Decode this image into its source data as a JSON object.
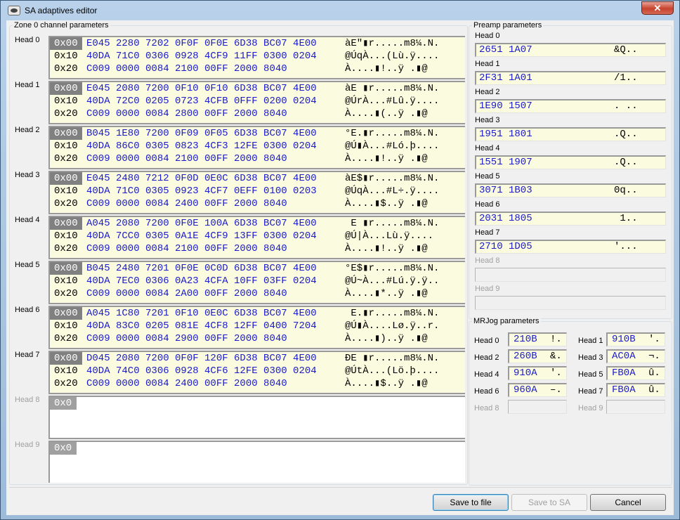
{
  "window": {
    "title": "SA adaptives editor",
    "close_glyph": "✕"
  },
  "zone": {
    "legend": "Zone 0 channel parameters",
    "heads": [
      {
        "label": "Head 0",
        "rows": [
          {
            "offset": "0x00",
            "words": "E045 2280 7202 0F0F 0F0E 6D38 BC07 4E00",
            "ascii": "àE\"▮r.....m8¼.N."
          },
          {
            "offset": "0x10",
            "words": "40DA 71C0 0306 0928 4CF9 11FF 0300 0204",
            "ascii": "@ÚqÀ...(Lù.ÿ...."
          },
          {
            "offset": "0x20",
            "words": "C009 0000 0084 2100 00FF 2000 8040",
            "ascii": "À....▮!..ÿ .▮@"
          }
        ]
      },
      {
        "label": "Head 1",
        "rows": [
          {
            "offset": "0x00",
            "words": "E045 2080 7200 0F10 0F10 6D38 BC07 4E00",
            "ascii": "àE ▮r.....m8¼.N."
          },
          {
            "offset": "0x10",
            "words": "40DA 72C0 0205 0723 4CFB 0FFF 0200 0204",
            "ascii": "@ÚrÀ...#Lû.ÿ...."
          },
          {
            "offset": "0x20",
            "words": "C009 0000 0084 2800 00FF 2000 8040",
            "ascii": "À....▮(..ÿ .▮@"
          }
        ]
      },
      {
        "label": "Head 2",
        "rows": [
          {
            "offset": "0x00",
            "words": "B045 1E80 7200 0F09 0F05 6D38 BC07 4E00",
            "ascii": "°E.▮r.....m8¼.N."
          },
          {
            "offset": "0x10",
            "words": "40DA 86C0 0305 0823 4CF3 12FE 0300 0204",
            "ascii": "@Ú▮À...#Ló.þ...."
          },
          {
            "offset": "0x20",
            "words": "C009 0000 0084 2100 00FF 2000 8040",
            "ascii": "À....▮!..ÿ .▮@"
          }
        ]
      },
      {
        "label": "Head 3",
        "rows": [
          {
            "offset": "0x00",
            "words": "E045 2480 7212 0F0D 0E0C 6D38 BC07 4E00",
            "ascii": "àE$▮r.....m8¼.N."
          },
          {
            "offset": "0x10",
            "words": "40DA 71C0 0305 0923 4CF7 0EFF 0100 0203",
            "ascii": "@ÚqÀ...#L÷.ÿ...."
          },
          {
            "offset": "0x20",
            "words": "C009 0000 0084 2400 00FF 2000 8040",
            "ascii": "À....▮$..ÿ .▮@"
          }
        ]
      },
      {
        "label": "Head 4",
        "rows": [
          {
            "offset": "0x00",
            "words": "A045 2080 7200 0F0E 100A 6D38 BC07 4E00",
            "ascii": " E ▮r.....m8¼.N."
          },
          {
            "offset": "0x10",
            "words": "40DA 7CC0 0305 0A1E 4CF9 13FF 0300 0204",
            "ascii": "@Ú|À...Lù.ÿ...."
          },
          {
            "offset": "0x20",
            "words": "C009 0000 0084 2100 00FF 2000 8040",
            "ascii": "À....▮!..ÿ .▮@"
          }
        ]
      },
      {
        "label": "Head 5",
        "rows": [
          {
            "offset": "0x00",
            "words": "B045 2480 7201 0F0E 0C0D 6D38 BC07 4E00",
            "ascii": "°E$▮r.....m8¼.N."
          },
          {
            "offset": "0x10",
            "words": "40DA 7EC0 0306 0A23 4CFA 10FF 03FF 0204",
            "ascii": "@Ú~À...#Lú.ÿ.ÿ.."
          },
          {
            "offset": "0x20",
            "words": "C009 0000 0084 2A00 00FF 2000 8040",
            "ascii": "À....▮*..ÿ .▮@"
          }
        ]
      },
      {
        "label": "Head 6",
        "rows": [
          {
            "offset": "0x00",
            "words": "A045 1C80 7201 0F10 0E0C 6D38 BC07 4E00",
            "ascii": " E.▮r.....m8¼.N."
          },
          {
            "offset": "0x10",
            "words": "40DA 83C0 0205 081E 4CF8 12FF 0400 7204",
            "ascii": "@Ú▮À....Lø.ÿ..r."
          },
          {
            "offset": "0x20",
            "words": "C009 0000 0084 2900 00FF 2000 8040",
            "ascii": "À....▮)..ÿ .▮@"
          }
        ]
      },
      {
        "label": "Head 7",
        "rows": [
          {
            "offset": "0x00",
            "words": "D045 2080 7200 0F0F 120F 6D38 BC07 4E00",
            "ascii": "ÐE ▮r.....m8¼.N."
          },
          {
            "offset": "0x10",
            "words": "40DA 74C0 0306 0928 4CF6 12FE 0300 0204",
            "ascii": "@ÚtÀ...(Lö.þ...."
          },
          {
            "offset": "0x20",
            "words": "C009 0000 0084 2400 00FF 2000 8040",
            "ascii": "À....▮$..ÿ .▮@"
          }
        ]
      },
      {
        "label": "Head 8",
        "empty_offset": "0x0"
      },
      {
        "label": "Head 9",
        "empty_offset": "0x0"
      }
    ]
  },
  "preamp": {
    "legend": "Preamp parameters",
    "heads": [
      {
        "label": "Head 0",
        "words": "2651 1A07",
        "ascii": "&Q.."
      },
      {
        "label": "Head 1",
        "words": "2F31 1A01",
        "ascii": "/1.."
      },
      {
        "label": "Head 2",
        "words": "1E90 1507",
        "ascii": ". .."
      },
      {
        "label": "Head 3",
        "words": "1951 1801",
        "ascii": ".Q.."
      },
      {
        "label": "Head 4",
        "words": "1551 1907",
        "ascii": ".Q.."
      },
      {
        "label": "Head 5",
        "words": "3071 1B03",
        "ascii": "0q.."
      },
      {
        "label": "Head 6",
        "words": "2031 1805",
        "ascii": " 1.."
      },
      {
        "label": "Head 7",
        "words": "2710 1D05",
        "ascii": "'..."
      },
      {
        "label": "Head 8",
        "words": "",
        "ascii": ""
      },
      {
        "label": "Head 9",
        "words": "",
        "ascii": ""
      }
    ]
  },
  "mrjog": {
    "legend": "MRJog parameters",
    "heads": [
      {
        "label": "Head 0",
        "words": "210B",
        "ascii": "!."
      },
      {
        "label": "Head 1",
        "words": "910B",
        "ascii": "'."
      },
      {
        "label": "Head 2",
        "words": "260B",
        "ascii": "&."
      },
      {
        "label": "Head 3",
        "words": "AC0A",
        "ascii": "¬."
      },
      {
        "label": "Head 4",
        "words": "910A",
        "ascii": "'."
      },
      {
        "label": "Head 5",
        "words": "FB0A",
        "ascii": "û."
      },
      {
        "label": "Head 6",
        "words": "960A",
        "ascii": "–."
      },
      {
        "label": "Head 7",
        "words": "FB0A",
        "ascii": "û."
      },
      {
        "label": "Head 8",
        "words": "",
        "ascii": ""
      },
      {
        "label": "Head 9",
        "words": "",
        "ascii": ""
      }
    ]
  },
  "buttons": {
    "save_file": "Save to file",
    "save_sa": "Save to SA",
    "cancel": "Cancel"
  }
}
